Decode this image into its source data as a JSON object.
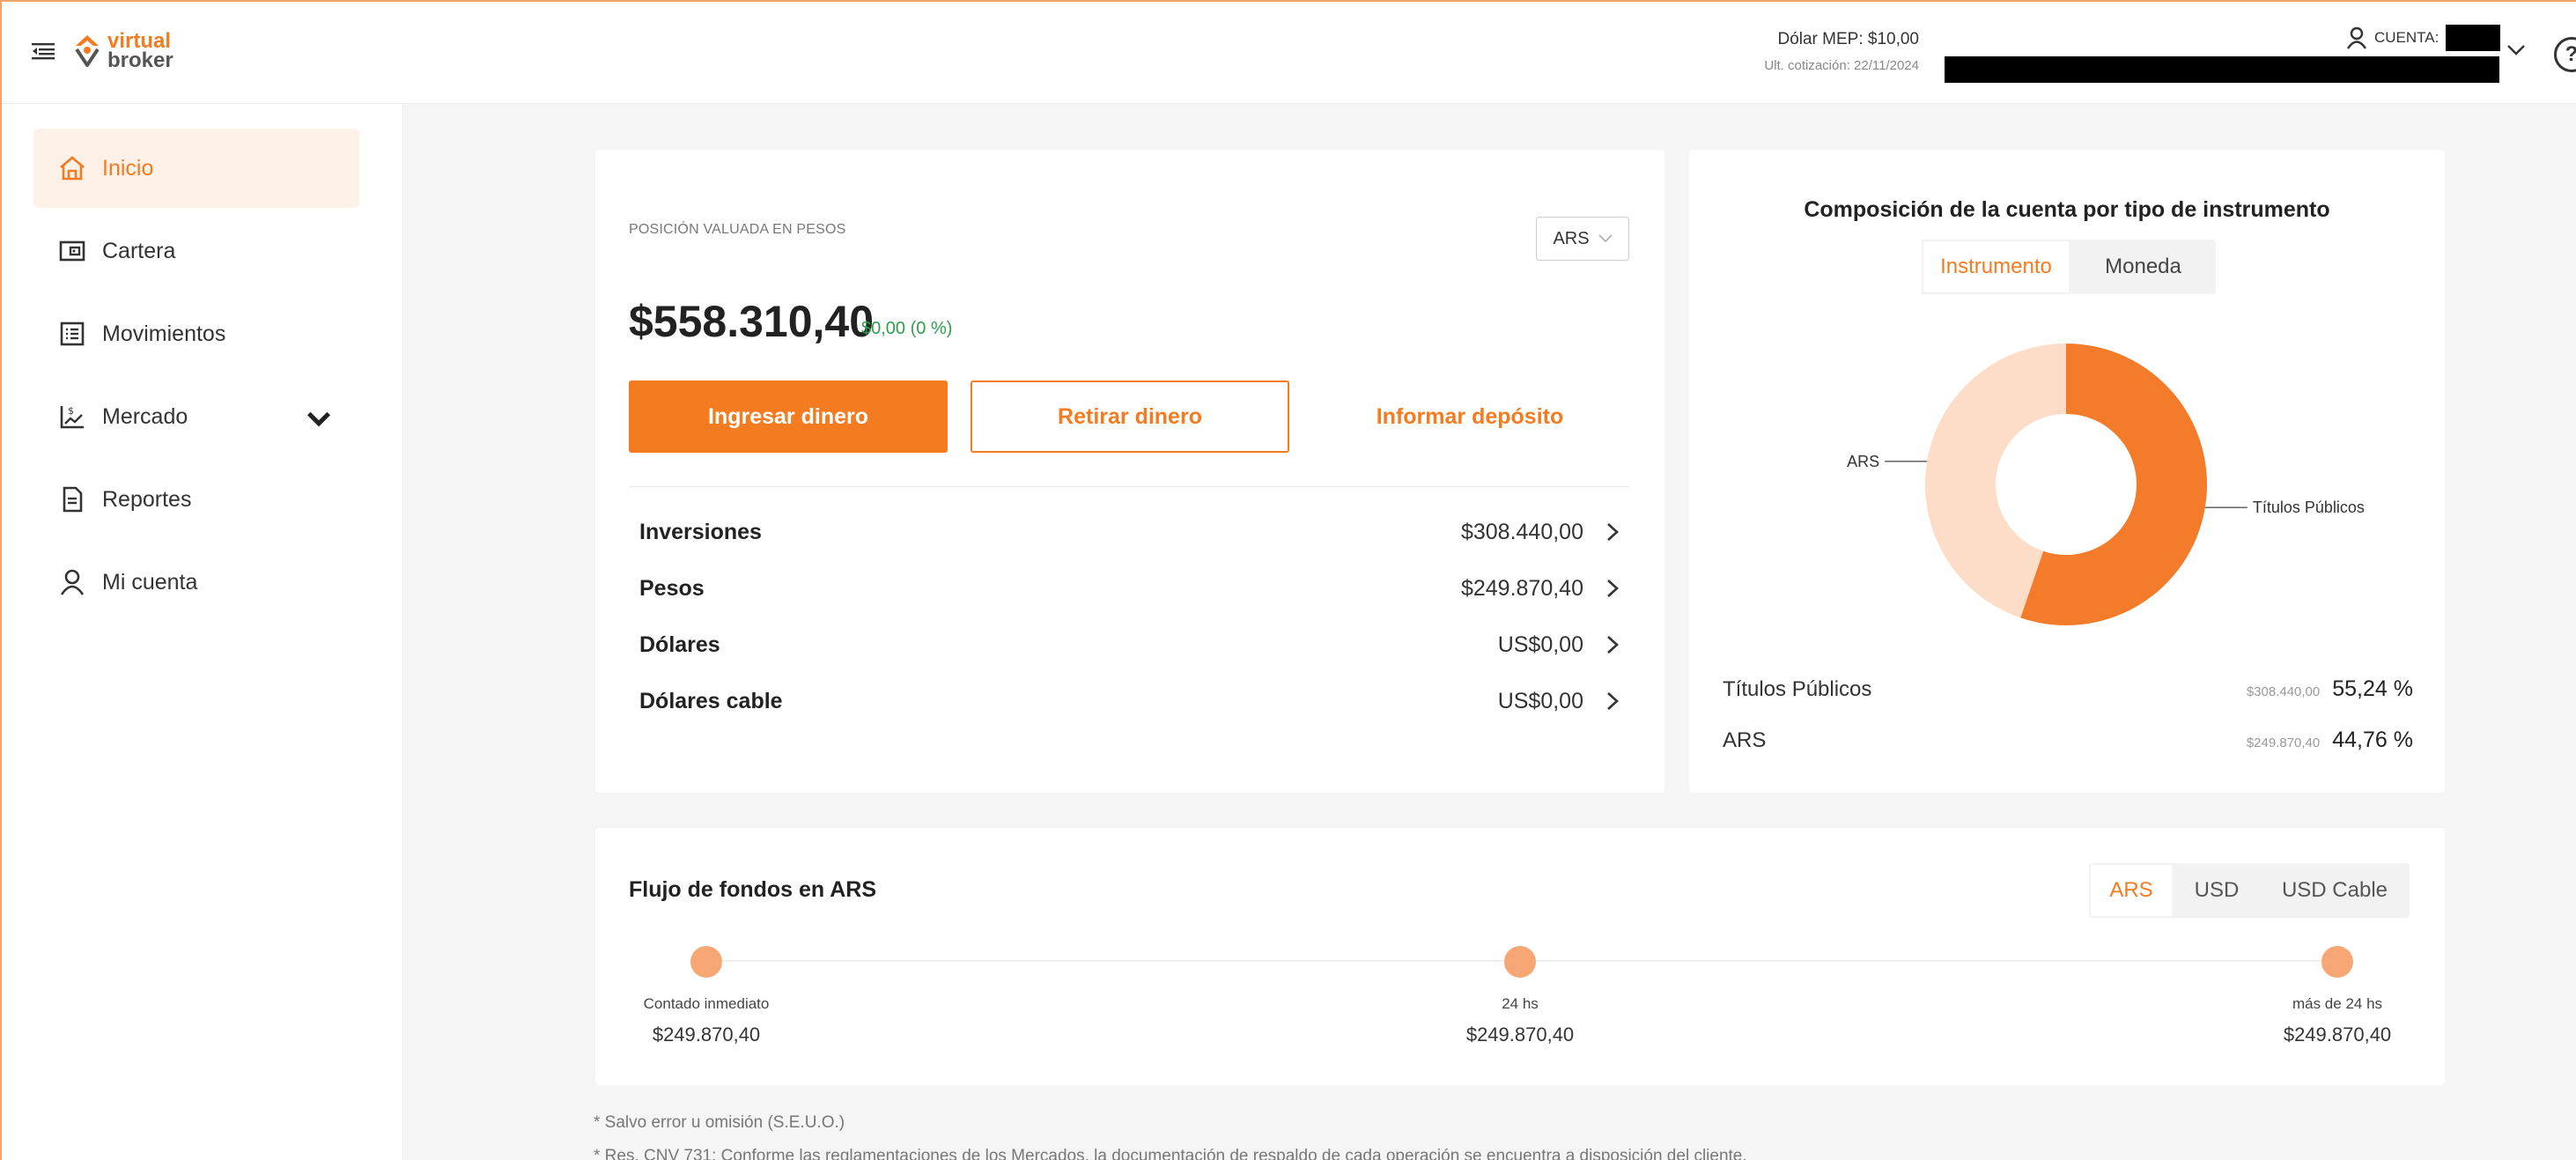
{
  "header": {
    "logo_line1": "virtual",
    "logo_line2": "broker",
    "mep_value": "Dólar MEP: $10,00",
    "mep_date": "Ult. cotización: 22/11/2024",
    "account_label": "CUENTA:"
  },
  "sidebar": {
    "items": [
      {
        "label": "Inicio",
        "icon": "home-icon",
        "active": true
      },
      {
        "label": "Cartera",
        "icon": "wallet-icon"
      },
      {
        "label": "Movimientos",
        "icon": "list-icon"
      },
      {
        "label": "Mercado",
        "icon": "market-chart-icon",
        "expandable": true
      },
      {
        "label": "Reportes",
        "icon": "document-icon"
      },
      {
        "label": "Mi cuenta",
        "icon": "user-icon"
      }
    ]
  },
  "position": {
    "label": "POSICIÓN VALUADA EN PESOS",
    "currency": "ARS",
    "amount": "$558.310,40",
    "change": "$0,00 (0 %)",
    "btn_deposit": "Ingresar dinero",
    "btn_withdraw": "Retirar dinero",
    "btn_inform": "Informar depósito",
    "rows": [
      {
        "label": "Inversiones",
        "value": "$308.440,00"
      },
      {
        "label": "Pesos",
        "value": "$249.870,40"
      },
      {
        "label": "Dólares",
        "value": "US$0,00"
      },
      {
        "label": "Dólares cable",
        "value": "US$0,00"
      }
    ]
  },
  "composition": {
    "title": "Composición de la cuenta por tipo de instrumento",
    "tabs": [
      "Instrumento",
      "Moneda"
    ],
    "active_tab": 0,
    "colors": {
      "titulos": "#f47b2a",
      "ars": "#fddcc8"
    },
    "items": [
      {
        "name": "Títulos Públicos",
        "amount": "$308.440,00",
        "pct": "55,24 %"
      },
      {
        "name": "ARS",
        "amount": "$249.870,40",
        "pct": "44,76 %"
      }
    ]
  },
  "chart_data": {
    "type": "pie",
    "categories": [
      "Títulos Públicos",
      "ARS"
    ],
    "values": [
      55.24,
      44.76
    ],
    "colors": [
      "#f47b2a",
      "#fddcc8"
    ],
    "donut": true
  },
  "flow": {
    "title": "Flujo de fondos en ARS",
    "tabs": [
      "ARS",
      "USD",
      "USD Cable"
    ],
    "active_tab": 0,
    "points": [
      {
        "label": "Contado inmediato",
        "amount": "$249.870,40"
      },
      {
        "label": "24 hs",
        "amount": "$249.870,40"
      },
      {
        "label": "más de 24 hs",
        "amount": "$249.870,40"
      }
    ]
  },
  "footnotes": [
    "* Salvo error u omisión (S.E.U.O.)",
    "* Res. CNV 731: Conforme las reglamentaciones de los Mercados, la documentación de respaldo de cada operación se encuentra a disposición del cliente."
  ]
}
